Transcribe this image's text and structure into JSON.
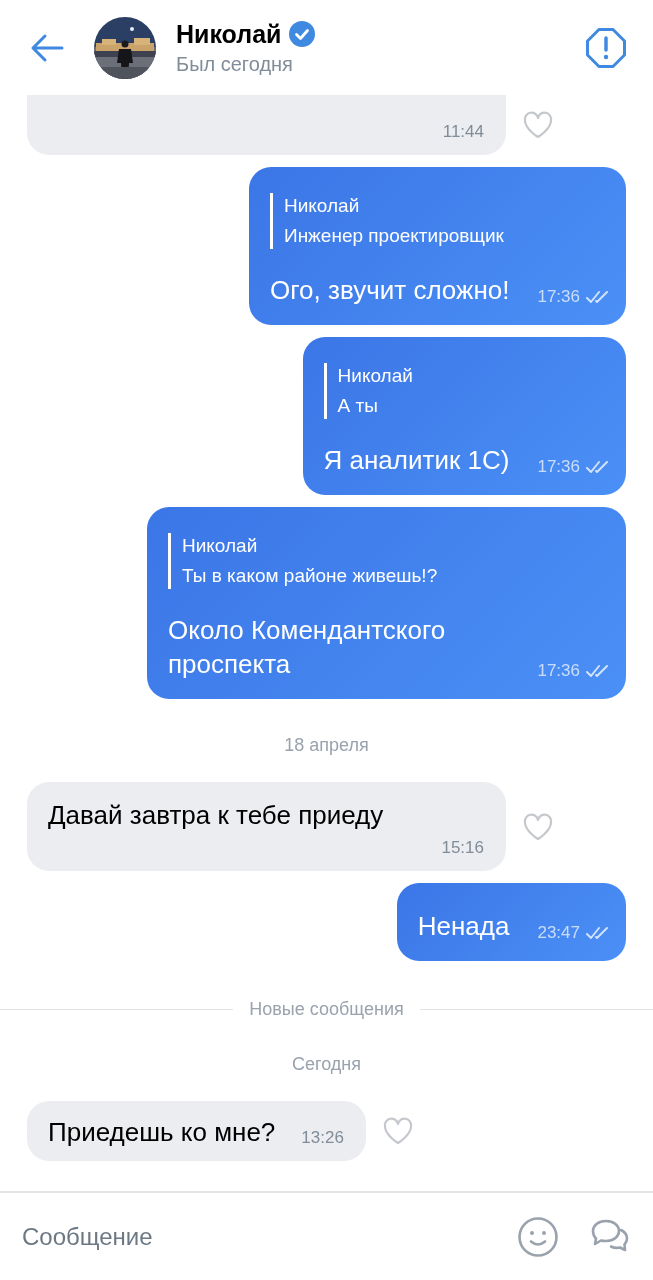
{
  "header": {
    "name": "Николай",
    "verified": true,
    "status": "Был сегодня"
  },
  "messages": [
    {
      "kind": "incoming",
      "time": "11:44",
      "liked": false,
      "clipped": true
    },
    {
      "kind": "outgoing",
      "reply": {
        "author": "Николай",
        "text": "Инженер проектировщик"
      },
      "text": "Ого, звучит сложно!",
      "time": "17:36",
      "read": true
    },
    {
      "kind": "outgoing",
      "reply": {
        "author": "Николай",
        "text": "А ты"
      },
      "text": "Я аналитик 1С)",
      "time": "17:36",
      "read": true
    },
    {
      "kind": "outgoing",
      "reply": {
        "author": "Николай",
        "text": "Ты в каком районе живешь!?"
      },
      "text": "Около Комендантского проспекта",
      "time": "17:36",
      "read": true
    },
    {
      "kind": "date",
      "text": "18 апреля"
    },
    {
      "kind": "incoming",
      "text": "Давай завтра к тебе приеду",
      "time": "15:16",
      "liked": false
    },
    {
      "kind": "outgoing",
      "text": "Ненада",
      "time": "23:47",
      "read": true
    },
    {
      "kind": "divider",
      "text": "Новые сообщения"
    },
    {
      "kind": "date",
      "text": "Сегодня"
    },
    {
      "kind": "incoming",
      "text": "Приедешь ко мне?",
      "time": "13:26",
      "liked": false
    }
  ],
  "composer": {
    "placeholder": "Сообщение"
  }
}
